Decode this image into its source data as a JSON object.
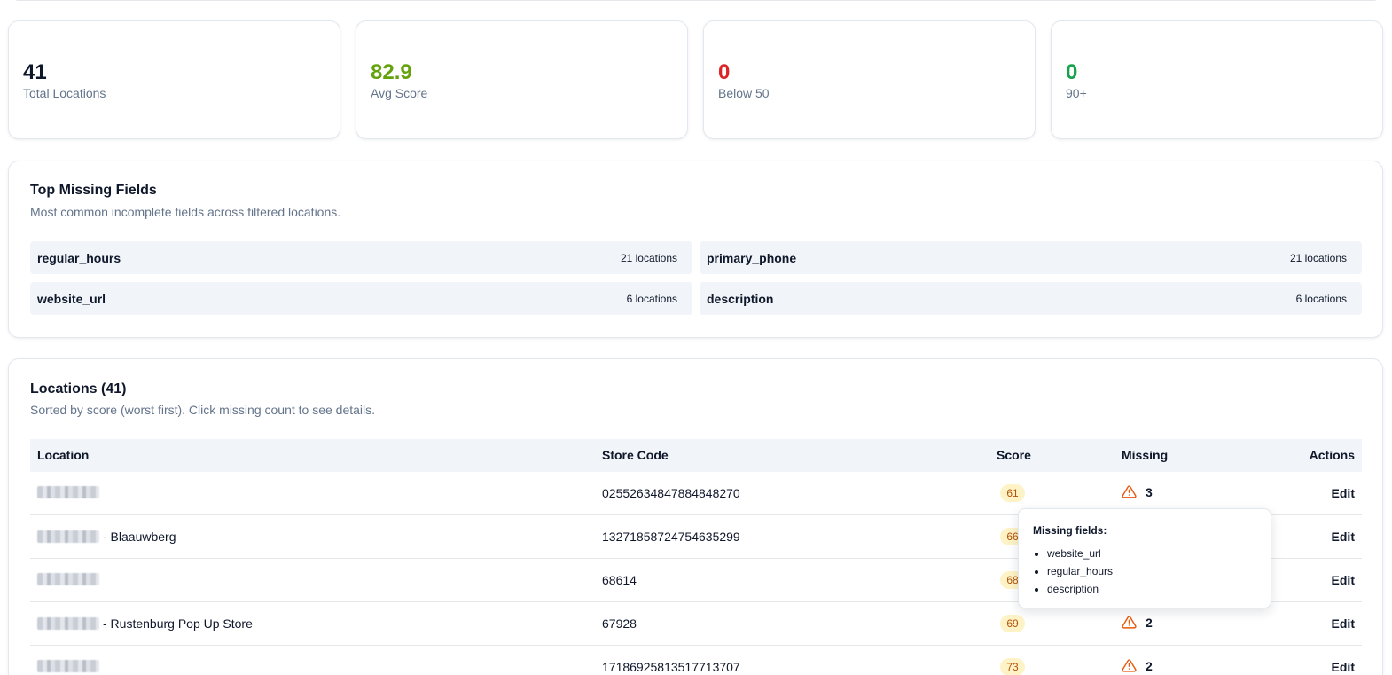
{
  "stats": [
    {
      "value": "41",
      "label": "Total Locations",
      "color": "#0f172a"
    },
    {
      "value": "82.9",
      "label": "Avg Score",
      "color": "#65a30d"
    },
    {
      "value": "0",
      "label": "Below 50",
      "color": "#dc2626"
    },
    {
      "value": "0",
      "label": "90+",
      "color": "#16a34a"
    }
  ],
  "missing_fields": {
    "title": "Top Missing Fields",
    "subtitle": "Most common incomplete fields across filtered locations.",
    "items": [
      {
        "name": "regular_hours",
        "count": "21 locations"
      },
      {
        "name": "primary_phone",
        "count": "21 locations"
      },
      {
        "name": "website_url",
        "count": "6 locations"
      },
      {
        "name": "description",
        "count": "6 locations"
      }
    ]
  },
  "locations": {
    "title": "Locations (41)",
    "subtitle": "Sorted by score (worst first). Click missing count to see details.",
    "columns": {
      "location": "Location",
      "store_code": "Store Code",
      "score": "Score",
      "missing": "Missing",
      "actions": "Actions"
    },
    "rows": [
      {
        "suffix": "",
        "store_code": "02552634847884848270",
        "score": "61",
        "missing": "3",
        "action": "Edit"
      },
      {
        "suffix": "- Blaauwberg",
        "store_code": "13271858724754635299",
        "score": "66",
        "missing": "",
        "action": "Edit"
      },
      {
        "suffix": "",
        "store_code": "68614",
        "score": "68",
        "missing": "",
        "action": "Edit"
      },
      {
        "suffix": "- Rustenburg Pop Up Store",
        "store_code": "67928",
        "score": "69",
        "missing": "2",
        "action": "Edit"
      },
      {
        "suffix": "",
        "store_code": "17186925813517713707",
        "score": "73",
        "missing": "2",
        "action": "Edit"
      }
    ]
  },
  "tooltip": {
    "title": "Missing fields:",
    "items": [
      "website_url",
      "regular_hours",
      "description"
    ]
  },
  "icons": {
    "missing": "warning-triangle-icon",
    "warning_color": "#ea580c"
  }
}
